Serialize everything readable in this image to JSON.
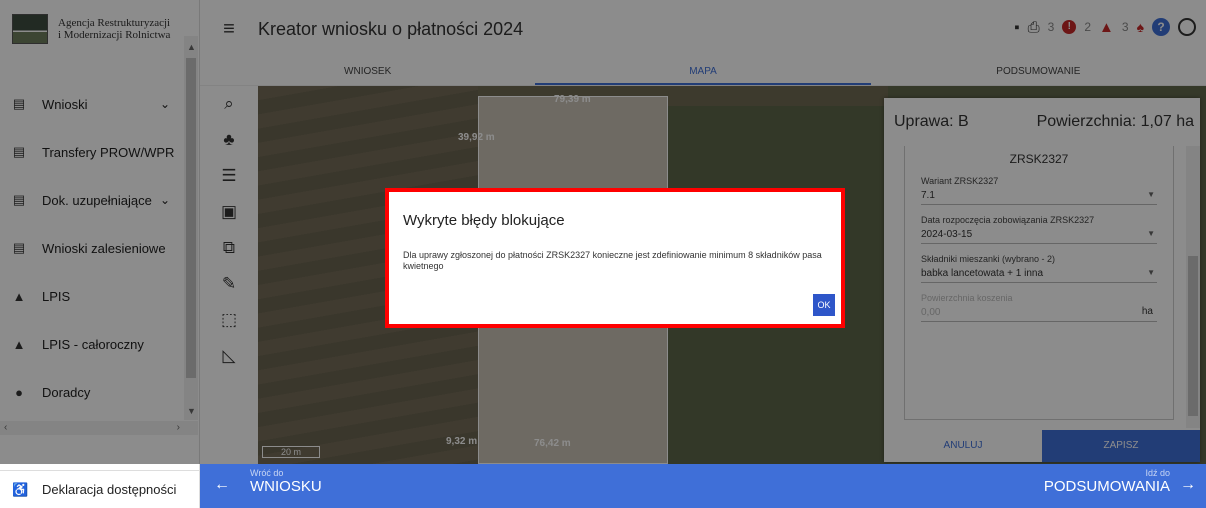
{
  "logo": {
    "line1": "Agencja Restrukturyzacji",
    "line2": "i Modernizacji Rolnictwa"
  },
  "sidebar": {
    "items": [
      {
        "label": "Wnioski",
        "icon": "clipboard-icon",
        "chevron": "⌄"
      },
      {
        "label": "Transfery PROW/WPR",
        "icon": "clipboard-icon",
        "chevron": ""
      },
      {
        "label": "Dok. uzupełniające",
        "icon": "clipboard-icon",
        "chevron": "⌄"
      },
      {
        "label": "Wnioski zalesieniowe",
        "icon": "clipboard-icon",
        "chevron": ""
      },
      {
        "label": "LPIS",
        "icon": "mountain-icon",
        "chevron": ""
      },
      {
        "label": "LPIS - całoroczny",
        "icon": "mountain-icon",
        "chevron": ""
      },
      {
        "label": "Doradcy",
        "icon": "person-icon",
        "chevron": ""
      }
    ],
    "footer": "Deklaracja dostępności"
  },
  "topbar": {
    "title": "Kreator wniosku o płatności 2024",
    "error_count": "3",
    "warning_count": "2",
    "notification_count": "3"
  },
  "tabs": [
    "WNIOSEK",
    "MAPA",
    "PODSUMOWANIE"
  ],
  "map": {
    "labels": [
      "79,39 m",
      "39,92 m",
      "9,32 m",
      "76,42 m",
      "20 m"
    ]
  },
  "panel": {
    "crop_label": "Uprawa: B",
    "area_label": "Powierzchnia: 1,07 ha",
    "section_title": "ZRSK2327",
    "fields": [
      {
        "label": "Wariant ZRSK2327",
        "value": "7.1"
      },
      {
        "label": "Data rozpoczęcia zobowiązania ZRSK2327",
        "value": "2024-03-15"
      },
      {
        "label": "Składniki mieszanki (wybrano - 2)",
        "value": "babka lancetowata + 1 inna"
      },
      {
        "label": "Powierzchnia koszenia",
        "value": "0,00",
        "unit": "ha"
      }
    ],
    "cancel": "ANULUJ",
    "save": "ZAPISZ"
  },
  "modal": {
    "title": "Wykryte błędy blokujące",
    "message": "Dla uprawy zgłoszonej do płatności ZRSK2327 konieczne jest zdefiniowanie minimum 8 składników pasa kwietnego",
    "ok": "OK"
  },
  "bottom": {
    "back_small": "Wróć do",
    "back_big": "WNIOSKU",
    "next_small": "Idź do",
    "next_big": "PODSUMOWANIA"
  }
}
